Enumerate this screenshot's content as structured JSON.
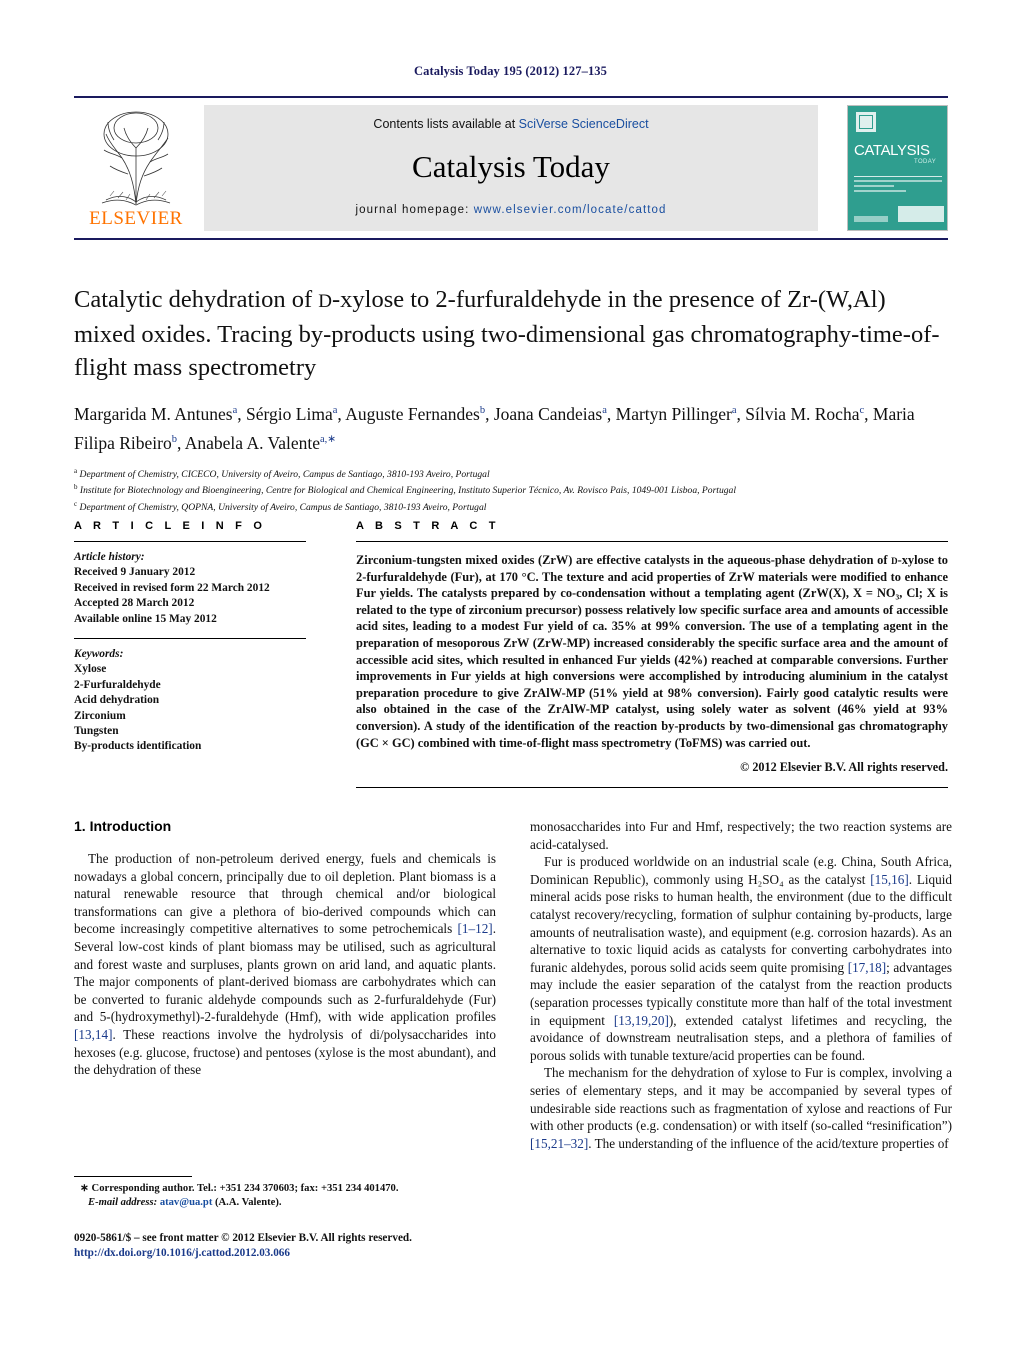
{
  "running_head": "Catalysis Today 195 (2012) 127–135",
  "masthead": {
    "contents_prefix": "Contents lists available at ",
    "sciencedirect": "SciVerse ScienceDirect",
    "journal_title": "Catalysis Today",
    "homepage_prefix": "journal homepage: ",
    "homepage_url": "www.elsevier.com/locate/cattod",
    "publisher": "ELSEVIER",
    "cover": {
      "title": "CATALYSIS",
      "subtitle": "TODAY",
      "accent_color": "#2f9e8f"
    }
  },
  "article": {
    "title_line1_a": "Catalytic dehydration of ",
    "title_smallcap": "d",
    "title_line1_b": "-xylose to 2-furfuraldehyde in the presence of",
    "title_line2": "Zr-(W,Al) mixed oxides. Tracing by-products using two-dimensional gas",
    "title_line3": "chromatography-time-of-flight mass spectrometry",
    "authors": [
      {
        "name": "Margarida M. Antunes",
        "sup": "a",
        "sep": ","
      },
      {
        "name": "Sérgio Lima",
        "sup": "a",
        "sep": ","
      },
      {
        "name": "Auguste Fernandes",
        "sup": "b",
        "sep": ","
      },
      {
        "name": "Joana Candeias",
        "sup": "a",
        "sep": ","
      },
      {
        "name": "Martyn Pillinger",
        "sup": "a",
        "sep": ","
      },
      {
        "name": "Sílvia M. Rocha",
        "sup": "c",
        "sep": ","
      },
      {
        "name": "Maria Filipa Ribeiro",
        "sup": "b",
        "sep": ","
      },
      {
        "name": "Anabela A. Valente",
        "sup": "a,∗",
        "sep": ""
      }
    ],
    "affiliations": [
      {
        "marker": "a",
        "text": "Department of Chemistry, CICECO, University of Aveiro, Campus de Santiago, 3810-193 Aveiro, Portugal"
      },
      {
        "marker": "b",
        "text": "Institute for Biotechnology and Bioengineering, Centre for Biological and Chemical Engineering, Instituto Superior Técnico, Av. Rovisco Pais, 1049-001 Lisboa, Portugal"
      },
      {
        "marker": "c",
        "text": "Department of Chemistry, QOPNA, University of Aveiro, Campus de Santiago, 3810-193 Aveiro, Portugal"
      }
    ]
  },
  "article_info": {
    "heading": "A R T I C L E   I N F O",
    "history_label": "Article history:",
    "history": [
      "Received 9 January 2012",
      "Received in revised form 22 March 2012",
      "Accepted 28 March 2012",
      "Available online 15 May 2012"
    ],
    "keywords_label": "Keywords:",
    "keywords": [
      "Xylose",
      "2-Furfuraldehyde",
      "Acid dehydration",
      "Zirconium",
      "Tungsten",
      "By-products identification"
    ]
  },
  "abstract": {
    "heading": "A B S T R A C T",
    "text": "Zirconium-tungsten mixed oxides (ZrW) are effective catalysts in the aqueous-phase dehydration of d-xylose to 2-furfuraldehyde (Fur), at 170 °C. The texture and acid properties of ZrW materials were modified to enhance Fur yields. The catalysts prepared by co-condensation without a templating agent (ZrW(X), X = NO3, Cl; X is related to the type of zirconium precursor) possess relatively low specific surface area and amounts of accessible acid sites, leading to a modest Fur yield of ca. 35% at 99% conversion. The use of a templating agent in the preparation of mesoporous ZrW (ZrW-MP) increased considerably the specific surface area and the amount of accessible acid sites, which resulted in enhanced Fur yields (42%) reached at comparable conversions. Further improvements in Fur yields at high conversions were accomplished by introducing aluminium in the catalyst preparation procedure to give ZrAlW-MP (51% yield at 98% conversion). Fairly good catalytic results were also obtained in the case of the ZrAlW-MP catalyst, using solely water as solvent (46% yield at 93% conversion). A study of the identification of the reaction by-products by two-dimensional gas chromatography (GC × GC) combined with time-of-flight mass spectrometry (ToFMS) was carried out.",
    "copyright": "© 2012 Elsevier B.V. All rights reserved."
  },
  "introduction": {
    "heading": "1.  Introduction",
    "left_paragraphs": [
      "The production of non-petroleum derived energy, fuels and chemicals is nowadays a global concern, principally due to oil depletion. Plant biomass is a natural renewable resource that through chemical and/or biological transformations can give a plethora of bio-derived compounds which can become increasingly competitive alternatives to some petrochemicals [1–12]. Several low-cost kinds of plant biomass may be utilised, such as agricultural and forest waste and surpluses, plants grown on arid land, and aquatic plants. The major components of plant-derived biomass are carbohydrates which can be converted to furanic aldehyde compounds such as 2-furfuraldehyde (Fur) and 5-(hydroxymethyl)-2-furaldehyde (Hmf), with wide application profiles [13,14]. These reactions involve the hydrolysis of di/polysaccharides into hexoses (e.g. glucose, fructose) and pentoses (xylose is the most abundant), and the dehydration of these"
    ],
    "right_paragraphs": [
      "monosaccharides into Fur and Hmf, respectively; the two reaction systems are acid-catalysed.",
      "Fur is produced worldwide on an industrial scale (e.g. China, South Africa, Dominican Republic), commonly using H2SO4 as the catalyst [15,16]. Liquid mineral acids pose risks to human health, the environment (due to the difficult catalyst recovery/recycling, formation of sulphur containing by-products, large amounts of neutralisation waste), and equipment (e.g. corrosion hazards). As an alternative to toxic liquid acids as catalysts for converting carbohydrates into furanic aldehydes, porous solid acids seem quite promising [17,18]; advantages may include the easier separation of the catalyst from the reaction products (separation processes typically constitute more than half of the total investment in equipment [13,19,20]), extended catalyst lifetimes and recycling, the avoidance of downstream neutralisation steps, and a plethora of families of porous solids with tunable texture/acid properties can be found.",
      "The mechanism for the dehydration of xylose to Fur is complex, involving a series of elementary steps, and it may be accompanied by several types of undesirable side reactions such as fragmentation of xylose and reactions of Fur with other products (e.g. condensation) or with itself (so-called “resinification”) [15,21–32]. The understanding of the influence of the acid/texture properties of"
    ]
  },
  "footer": {
    "corresponding_marker": "∗",
    "corresponding_text": "Corresponding author. Tel.: +351 234 370603; fax: +351 234 401470.",
    "email_label": "E-mail address:",
    "email": "atav@ua.pt",
    "email_owner": "(A.A. Valente).",
    "imprint": "0920-5861/$ – see front matter © 2012 Elsevier B.V. All rights reserved.",
    "doi": "http://dx.doi.org/10.1016/j.cattod.2012.03.066"
  }
}
